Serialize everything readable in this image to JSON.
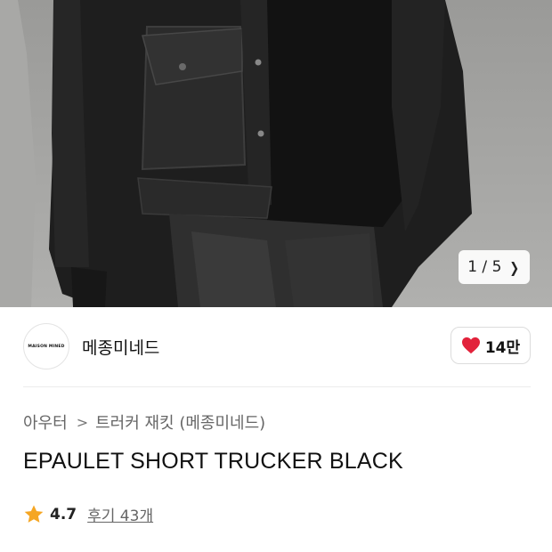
{
  "gallery": {
    "current": "1",
    "separator": "/",
    "total": "5"
  },
  "brand": {
    "logo_text": "MAISON MINED",
    "name": "메종미네드"
  },
  "like": {
    "count": "14만",
    "color": "#e2223b"
  },
  "breadcrumb": {
    "category": "아우터",
    "subcategory": "트러커 재킷 (메종미네드)"
  },
  "product": {
    "title": "EPAULET SHORT TRUCKER BLACK"
  },
  "rating": {
    "score": "4.7",
    "reviews": "후기 43개",
    "star_color": "#f5a623"
  }
}
